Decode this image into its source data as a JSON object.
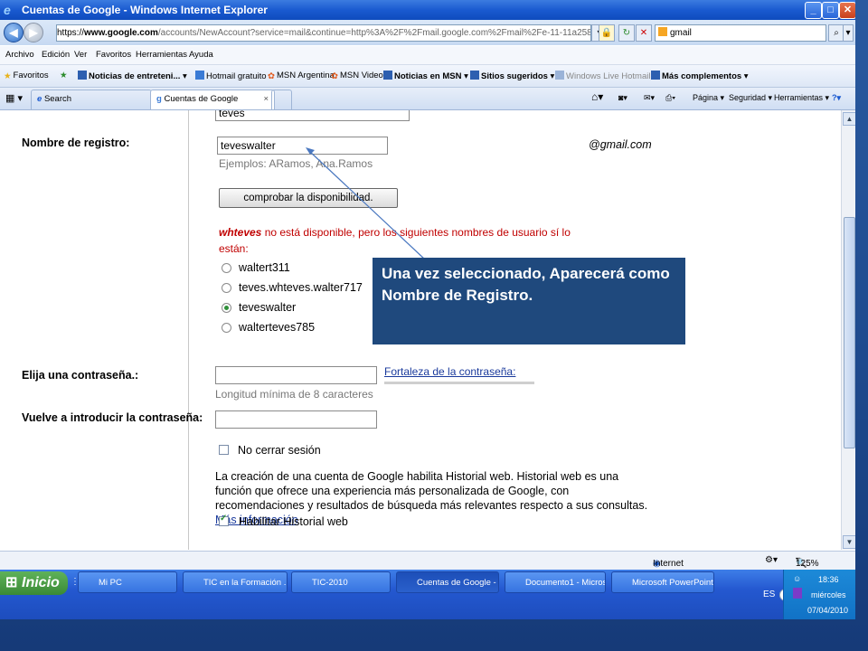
{
  "window": {
    "title": "Cuentas de Google - Windows Internet Explorer"
  },
  "address": {
    "url_https": "https://",
    "url_domain": "www.google.com",
    "url_rest": "/accounts/NewAccount?service=mail&continue=http%3A%2F%2Fmail.google.com%2Fmail%2Fe-11-11a258d1b7d78c388aa8e265e5",
    "search_value": "gmail"
  },
  "menu": [
    "Archivo",
    "Edición",
    "Ver",
    "Favoritos",
    "Herramientas",
    "Ayuda"
  ],
  "favorites": {
    "label": "Favoritos",
    "items": [
      "Noticias de entreteni...",
      "Hotmail gratuito",
      "MSN Argentina",
      "MSN Video",
      "Noticias en MSN",
      "Sitios sugeridos",
      "Windows Live Hotmail",
      "Más complementos"
    ]
  },
  "tabs": {
    "search": "Search",
    "active": "Cuentas de Google",
    "close": "×"
  },
  "tab_tools": {
    "page": "Página",
    "security": "Seguridad",
    "tools": "Herramientas"
  },
  "form": {
    "last_name_value": "teves",
    "username_label": "Nombre de registro:",
    "username_value": "teveswalter",
    "domain_suffix": "@gmail.com",
    "username_examples": "Ejemplos: ARamos, Ana.Ramos",
    "check_button": "comprobar la disponibilidad.",
    "unavailable_user": "whteves",
    "unavailable_text_1": " no está disponible, pero los siguientes nombres de usuario sí lo",
    "unavailable_text_2": "están:",
    "suggestions": [
      "waltert311",
      "teves.whteves.walter717",
      "teveswalter",
      "walterteves785"
    ],
    "selected_index": 2,
    "password_label": "Elija una contraseña.:",
    "password_strength_link": "Fortaleza de la contraseña:",
    "password_hint": "Longitud mínima de 8 caracteres",
    "password_confirm_label": "Vuelve a introducir la contraseña:",
    "stay_signed_in": "No cerrar sesión",
    "history_text": "La creación de una cuenta de Google habilita Historial web. Historial web es una función que ofrece una experiencia más personalizada de Google, con recomendaciones y resultados de búsqueda más relevantes respecto a sus consultas.",
    "more_info_link": "Más información",
    "enable_history": "Habilitar Historial web"
  },
  "callout": {
    "text": "Una vez seleccionado, Aparecerá como Nombre de Registro."
  },
  "status": {
    "zone": "Internet",
    "zoom": "125%"
  },
  "taskbar": {
    "start": "Inicio",
    "tasks": [
      "Mi PC",
      "TIC en la Formación ...",
      "TIC-2010",
      "Cuentas de Google - ...",
      "Documento1 - Micros...",
      "Microsoft PowerPoint ..."
    ],
    "lang": "ES",
    "time": "18:36",
    "day": "miércoles",
    "date": "07/04/2010"
  }
}
